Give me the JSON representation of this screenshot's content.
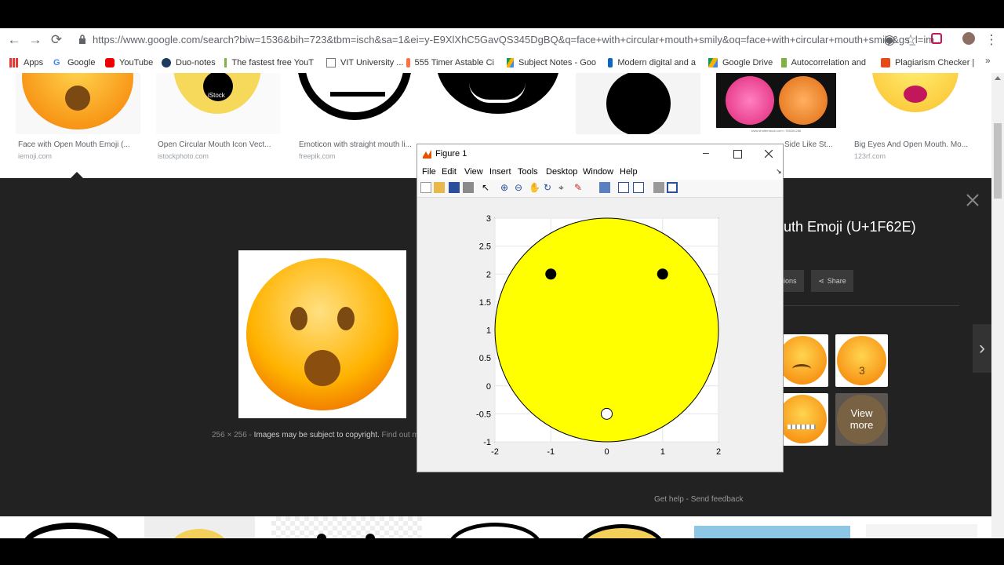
{
  "browser": {
    "url": "https://www.google.com/search?biw=1536&bih=723&tbm=isch&sa=1&ei=y-E9XlXhC5GavQS345DgBQ&q=face+with+circular+mouth+smily&oq=face+with+circular+mouth+smily&gs_l=im...",
    "bookmarks": [
      "Apps",
      "Google",
      "YouTube",
      "Duo-notes",
      "The fastest free YouT",
      "VIT University ...",
      "555 Timer Astable Ci",
      "Subject Notes - Goo",
      "Modern digital and a",
      "Google Drive",
      "Autocorrelation and",
      "Plagiarism Checker | "
    ]
  },
  "results": [
    {
      "caption": "Face with Open Mouth Emoji (...",
      "source": "iemoji.com"
    },
    {
      "caption": "Open Circular Mouth Icon Vect...",
      "source": "istockphoto.com"
    },
    {
      "caption": "Emoticon with straight mouth li...",
      "source": "freepik.com"
    },
    {
      "caption": "",
      "source": ""
    },
    {
      "caption": "",
      "source": ""
    },
    {
      "caption": "Side Like St...",
      "source": ""
    },
    {
      "caption": "Big Eyes And Open Mouth. Mo...",
      "source": "123rf.com"
    }
  ],
  "stock_watermark": "iStock",
  "shutterstock_caption": "www.shutterstock.com • 765261286",
  "preview": {
    "title_fragment": "uth Emoji (U+1F62E)",
    "share_label": "Share",
    "options_fragment": "ions",
    "dimensions": "256 × 256",
    "copyright": "Images may be subject to copyright.",
    "find_out": "Find out m",
    "view_more": "View more",
    "get_help": "Get help",
    "send_feedback": "Send feedback",
    "separator": "-"
  },
  "figure": {
    "title": "Figure 1",
    "menu": [
      "File",
      "Edit",
      "View",
      "Insert",
      "Tools",
      "Desktop",
      "Window",
      "Help"
    ],
    "dock_arrow": "↘"
  },
  "chart_data": {
    "type": "scatter",
    "title": "",
    "xlabel": "",
    "ylabel": "",
    "xlim": [
      -2,
      2
    ],
    "ylim": [
      -1,
      3
    ],
    "xticks": [
      "-2",
      "-1",
      "0",
      "1",
      "2"
    ],
    "yticks": [
      "-1",
      "-0.5",
      "0",
      "0.5",
      "1",
      "1.5",
      "2",
      "2.5",
      "3"
    ],
    "grid": true,
    "face": {
      "center": [
        0,
        1
      ],
      "radius": 2,
      "fill": "#ffff00"
    },
    "eyes": [
      {
        "x": -1,
        "y": 2,
        "fill": "#000000"
      },
      {
        "x": 1,
        "y": 2,
        "fill": "#000000"
      }
    ],
    "mouth": {
      "x": 0,
      "y": -0.5,
      "fill": "#ffffff"
    }
  },
  "colors": {
    "panel": "#222222",
    "face": "#ffff00",
    "accent": "#1a73e8"
  }
}
